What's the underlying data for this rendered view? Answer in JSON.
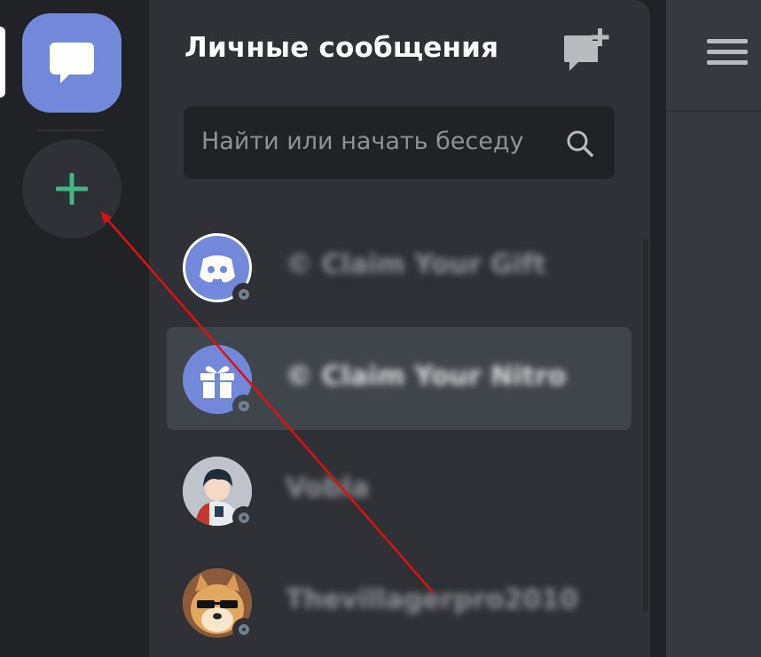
{
  "dm_panel": {
    "title": "Личные сообщения",
    "search": {
      "placeholder": "Найти или начать беседу"
    },
    "conversations": [
      {
        "name": "© Claim Your Gift",
        "avatar_icon": "discord-logo-icon",
        "avatar_color": "#7289da",
        "status": "offline",
        "selected": false
      },
      {
        "name": "© Claim Your Nitro",
        "avatar_icon": "gift-icon",
        "avatar_color": "#7289da",
        "status": "offline",
        "selected": true
      },
      {
        "name": "Vobla",
        "avatar_icon": "anime-avatar-image",
        "status": "offline",
        "selected": false
      },
      {
        "name": "Thevillagerpro2010",
        "avatar_icon": "doge-sunglasses-avatar-image",
        "status": "offline",
        "selected": false
      }
    ]
  },
  "colors": {
    "brand": "#7289da",
    "add_server_green": "#43b581",
    "annotation_arrow": "#e01010",
    "status_offline": "#747f8d"
  },
  "icons": {
    "home": "chat-bubble-icon",
    "add_server": "plus-icon",
    "new_dm": "new-message-icon",
    "search": "search-icon",
    "menu": "hamburger-menu-icon"
  }
}
